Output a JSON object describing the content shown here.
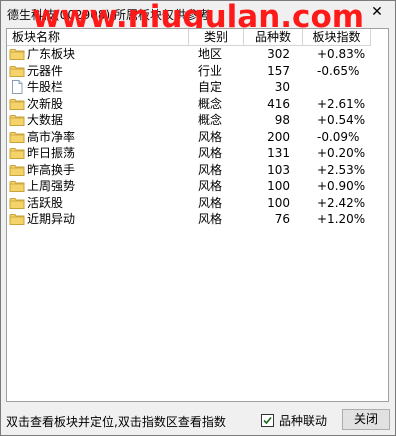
{
  "window": {
    "title": "德生科技(002908) 所属板块仅供参考",
    "watermark": "www.niugulan.com",
    "close_glyph": "✕"
  },
  "table": {
    "headers": {
      "name": "板块名称",
      "type": "类别",
      "count": "品种数",
      "index": "板块指数"
    },
    "rows": [
      {
        "name": "广东板块",
        "type": "地区",
        "count": "302",
        "index": "+0.83%",
        "icon": "folder-icon"
      },
      {
        "name": "元器件",
        "type": "行业",
        "count": "157",
        "index": "-0.65%",
        "icon": "folder-icon"
      },
      {
        "name": "牛股栏",
        "type": "自定",
        "count": "30",
        "index": "",
        "icon": "document-icon"
      },
      {
        "name": "次新股",
        "type": "概念",
        "count": "416",
        "index": "+2.61%",
        "icon": "folder-icon"
      },
      {
        "name": "大数据",
        "type": "概念",
        "count": "98",
        "index": "+0.54%",
        "icon": "folder-icon"
      },
      {
        "name": "高市净率",
        "type": "风格",
        "count": "200",
        "index": "-0.09%",
        "icon": "folder-icon"
      },
      {
        "name": "昨日振荡",
        "type": "风格",
        "count": "131",
        "index": "+0.20%",
        "icon": "folder-icon"
      },
      {
        "name": "昨高换手",
        "type": "风格",
        "count": "103",
        "index": "+2.53%",
        "icon": "folder-icon"
      },
      {
        "name": "上周强势",
        "type": "风格",
        "count": "100",
        "index": "+0.90%",
        "icon": "folder-icon"
      },
      {
        "name": "活跃股",
        "type": "风格",
        "count": "100",
        "index": "+2.42%",
        "icon": "folder-icon"
      },
      {
        "name": "近期异动",
        "type": "风格",
        "count": "76",
        "index": "+1.20%",
        "icon": "folder-icon"
      }
    ]
  },
  "status": {
    "hint": "双击查看板块并定位,双击指数区查看指数",
    "checkbox_label": "品种联动",
    "checkbox_checked": true,
    "close_label": "关闭"
  },
  "colors": {
    "folder": "#f5d36b",
    "folder_dark": "#c9a23a",
    "watermark": "#ff1a1a",
    "checkmark": "#1e6a1e"
  }
}
